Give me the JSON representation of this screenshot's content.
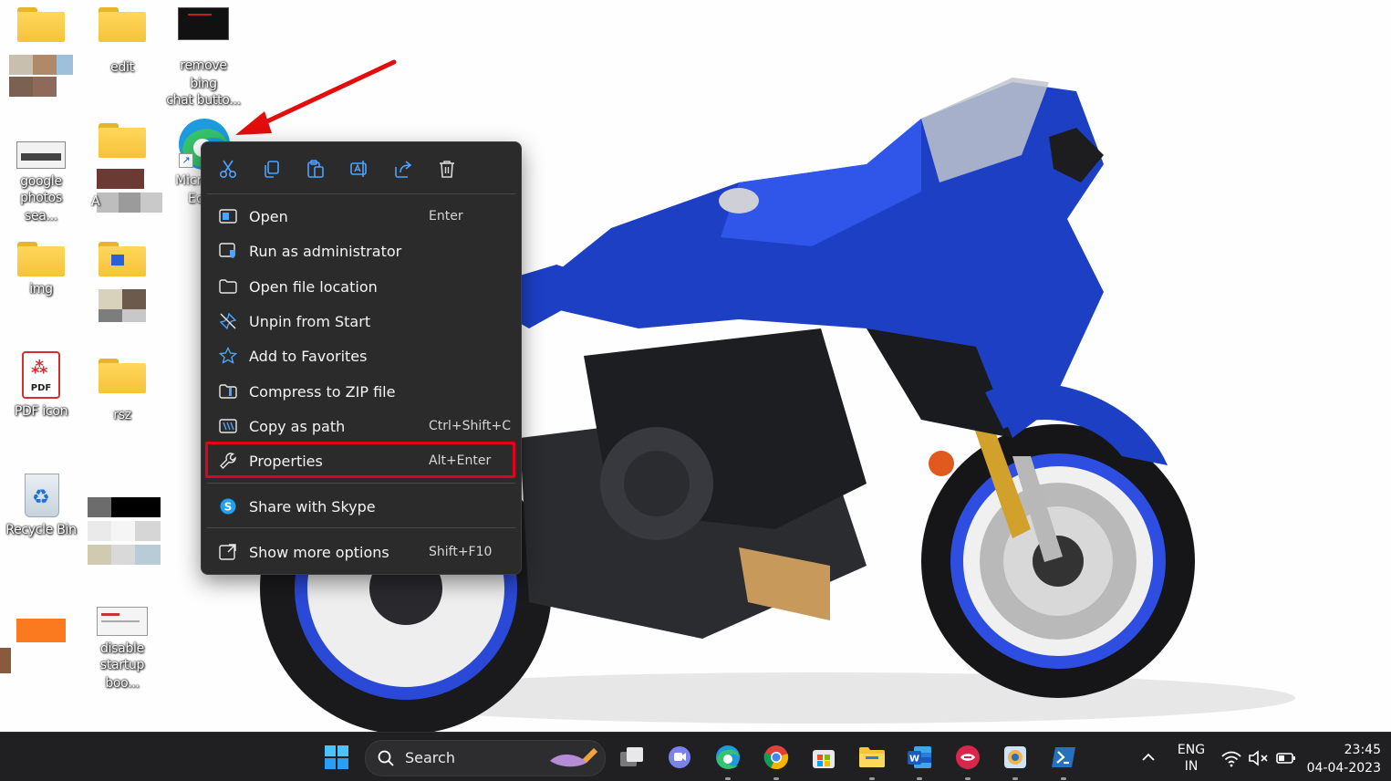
{
  "desktop": {
    "icons": [
      {
        "id": "folder-1",
        "label": ""
      },
      {
        "id": "folder-edit",
        "label": "edit"
      },
      {
        "id": "remove-bing",
        "label_line1": "remove bing",
        "label_line2": "chat butto..."
      },
      {
        "id": "google-photos",
        "label_line1": "google",
        "label_line2": "photos sea..."
      },
      {
        "id": "folder-a",
        "label": "A"
      },
      {
        "id": "edge-shortcut",
        "label_line1": "Micr",
        "label_line2": "Ed"
      },
      {
        "id": "folder-img",
        "label": "img"
      },
      {
        "id": "pdf-icon",
        "label": "PDF icon",
        "badge": "PDF"
      },
      {
        "id": "folder-rsz",
        "label": "rsz"
      },
      {
        "id": "recycle-bin",
        "label": "Recycle Bin"
      },
      {
        "id": "disable-startup",
        "label_line1": "disable",
        "label_line2": "startup boo..."
      }
    ]
  },
  "context_menu": {
    "toolbar": [
      {
        "name": "cut",
        "icon": "scissors-icon"
      },
      {
        "name": "copy",
        "icon": "copy-icon"
      },
      {
        "name": "paste",
        "icon": "paste-icon"
      },
      {
        "name": "rename",
        "icon": "rename-icon"
      },
      {
        "name": "share",
        "icon": "share-icon"
      },
      {
        "name": "delete",
        "icon": "trash-icon"
      }
    ],
    "items": [
      {
        "label": "Open",
        "shortcut": "Enter",
        "icon": "open-app-icon"
      },
      {
        "label": "Run as administrator",
        "shortcut": "",
        "icon": "admin-shield-icon"
      },
      {
        "label": "Open file location",
        "shortcut": "",
        "icon": "folder-outline-icon"
      },
      {
        "label": "Unpin from Start",
        "shortcut": "",
        "icon": "unpin-icon"
      },
      {
        "label": "Add to Favorites",
        "shortcut": "",
        "icon": "star-icon"
      },
      {
        "label": "Compress to ZIP file",
        "shortcut": "",
        "icon": "zip-icon"
      },
      {
        "label": "Copy as path",
        "shortcut": "Ctrl+Shift+C",
        "icon": "copy-path-icon"
      },
      {
        "label": "Properties",
        "shortcut": "Alt+Enter",
        "icon": "wrench-icon",
        "highlighted": true
      },
      {
        "label": "Share with Skype",
        "shortcut": "",
        "icon": "skype-icon"
      },
      {
        "label": "Show more options",
        "shortcut": "Shift+F10",
        "icon": "more-options-icon"
      }
    ]
  },
  "taskbar": {
    "search_label": "Search",
    "apps": [
      "start",
      "search",
      "task-view",
      "teams",
      "edge",
      "chrome",
      "store",
      "file-explorer",
      "word",
      "app-red",
      "photos",
      "powershell"
    ],
    "tray": {
      "language_line1": "ENG",
      "language_line2": "IN",
      "time": "23:45",
      "date": "04-04-2023"
    }
  },
  "colors": {
    "menu_bg": "#2b2b2c",
    "highlight_border": "#e3001b",
    "accent_blue": "#4da3ff",
    "taskbar_bg": "#202023",
    "bike_blue": "#1c3fc4"
  }
}
